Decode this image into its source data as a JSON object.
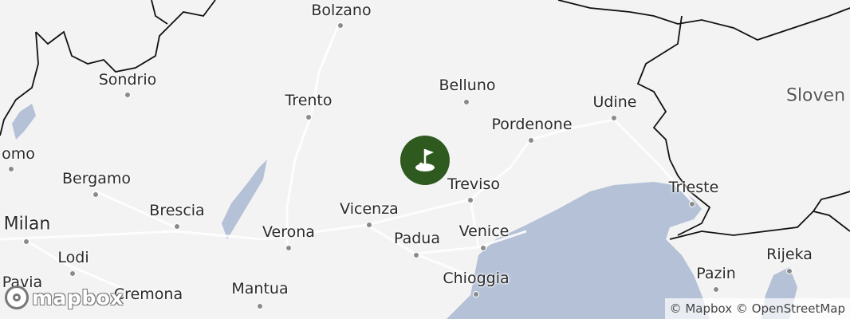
{
  "map": {
    "colors": {
      "land": "#f3f3f3",
      "water": "#b4c1d7",
      "border": "#111111",
      "road": "#ffffff",
      "marker": "#2f5a1f"
    },
    "labels": {
      "bolzano": "Bolzano",
      "sondrio": "Sondrio",
      "trento": "Trento",
      "belluno": "Belluno",
      "udine": "Udine",
      "slovenia": "Sloven",
      "pordenone": "Pordenone",
      "como": "omo",
      "bergamo": "Bergamo",
      "treviso": "Treviso",
      "trieste": "Trieste",
      "milan": "Milan",
      "brescia": "Brescia",
      "vicenza": "Vicenza",
      "verona": "Verona",
      "padua": "Padua",
      "venice": "Venice",
      "lodi": "Lodi",
      "rijeka": "Rijeka",
      "pazin": "Pazin",
      "pavia": "Pavia",
      "chioggia": "Chioggia",
      "mantua": "Mantua",
      "cremona": "Cremona"
    },
    "marker_icon": "golf-flag-icon"
  },
  "logo": {
    "text": "mapbox",
    "icon": "mapbox-logo-icon"
  },
  "attribution": {
    "mapbox": "© Mapbox",
    "osm": "© OpenStreetMap"
  }
}
